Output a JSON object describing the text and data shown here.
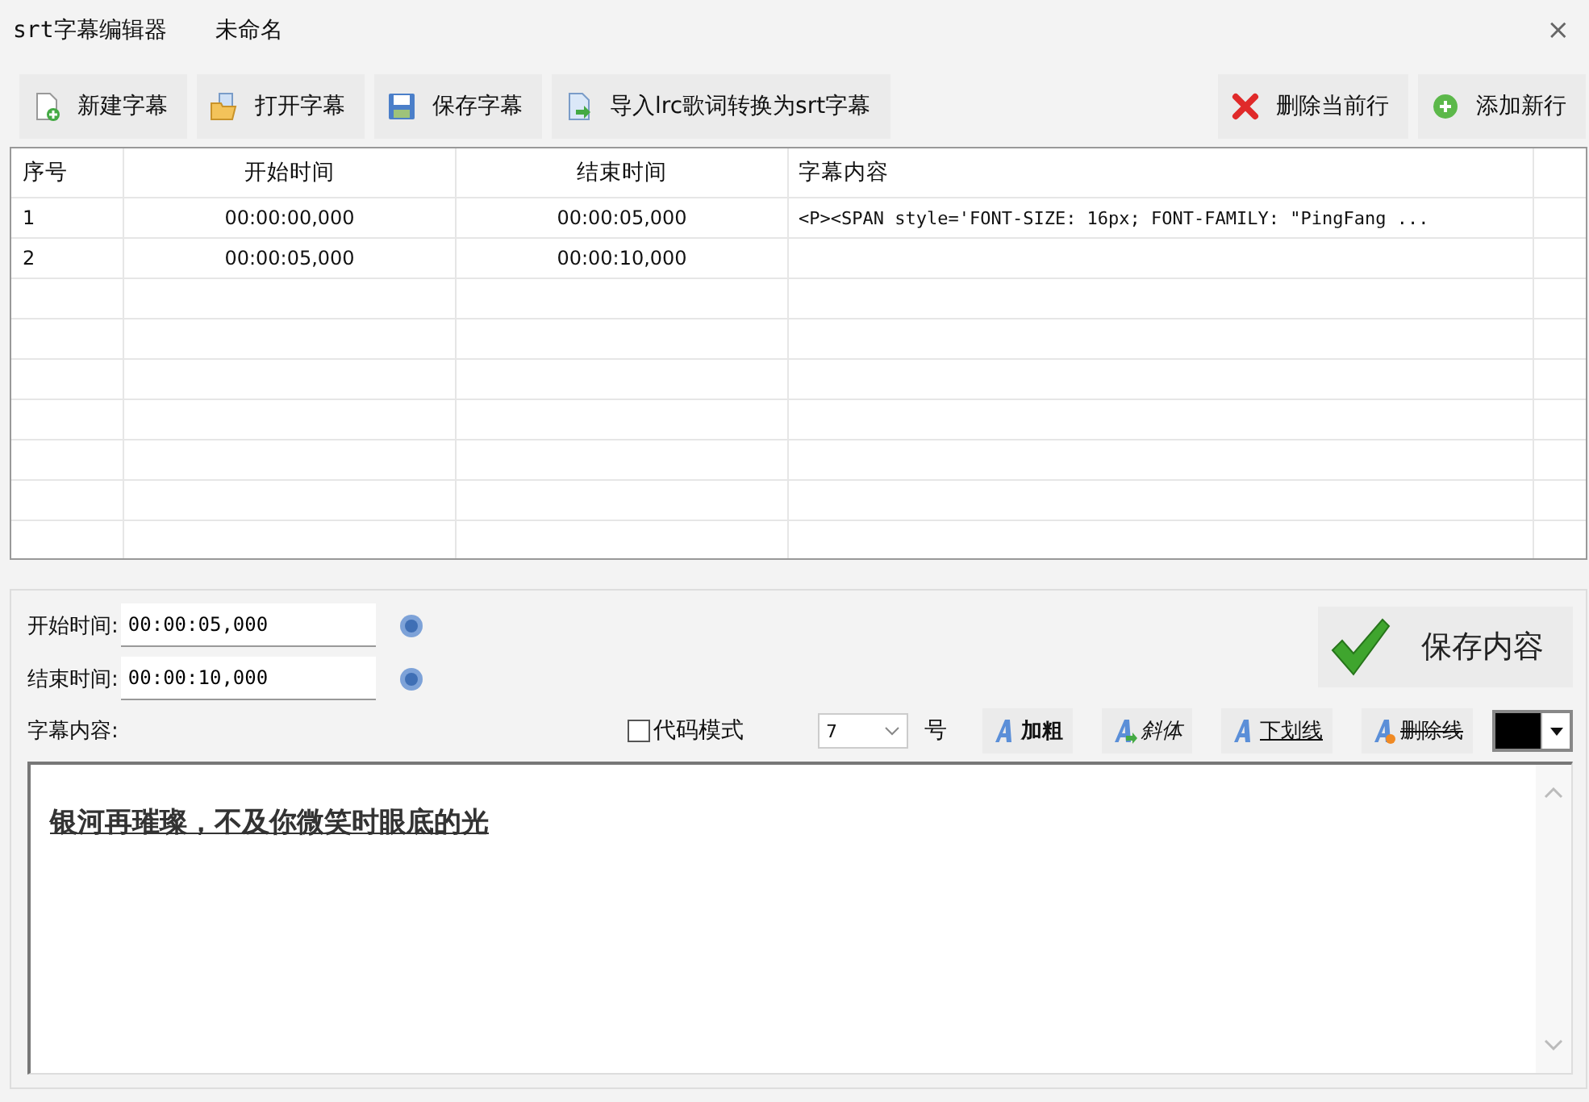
{
  "window": {
    "title": "srt字幕编辑器",
    "document": "未命名",
    "close": "×"
  },
  "toolbar": {
    "left": [
      {
        "kind": "new",
        "label": "新建字幕"
      },
      {
        "kind": "open",
        "label": "打开字幕"
      },
      {
        "kind": "save",
        "label": "保存字幕"
      },
      {
        "kind": "import",
        "label": "导入lrc歌词转换为srt字幕"
      }
    ],
    "right": [
      {
        "kind": "delete",
        "label": "删除当前行"
      },
      {
        "kind": "add",
        "label": "添加新行"
      }
    ]
  },
  "table": {
    "columns": [
      "序号",
      "开始时间",
      "结束时间",
      "字幕内容"
    ],
    "rows": [
      [
        "1",
        "00:00:00,000",
        "00:00:05,000",
        "<P><SPAN style='FONT-SIZE: 16px; FONT-FAMILY: \"PingFang ..."
      ],
      [
        "2",
        "00:00:05,000",
        "00:00:10,000",
        ""
      ]
    ]
  },
  "editor": {
    "start_label": "开始时间:",
    "start_value": "00:00:05,000",
    "end_label": "结束时间:",
    "end_value": "00:00:10,000",
    "save_button": "保存内容",
    "content_label": "字幕内容:",
    "code_mode": {
      "label": "代码模式",
      "checked": false
    },
    "font_size": "7",
    "font_size_unit": "号",
    "format_buttons": [
      {
        "kind": "bold",
        "label": "加粗"
      },
      {
        "kind": "italic",
        "label": "斜体"
      },
      {
        "kind": "underline",
        "label": "下划线"
      },
      {
        "kind": "strike",
        "label": "删除线"
      }
    ],
    "color": "#000000",
    "content": "银河再璀璨，不及你微笑时眼底的光"
  }
}
